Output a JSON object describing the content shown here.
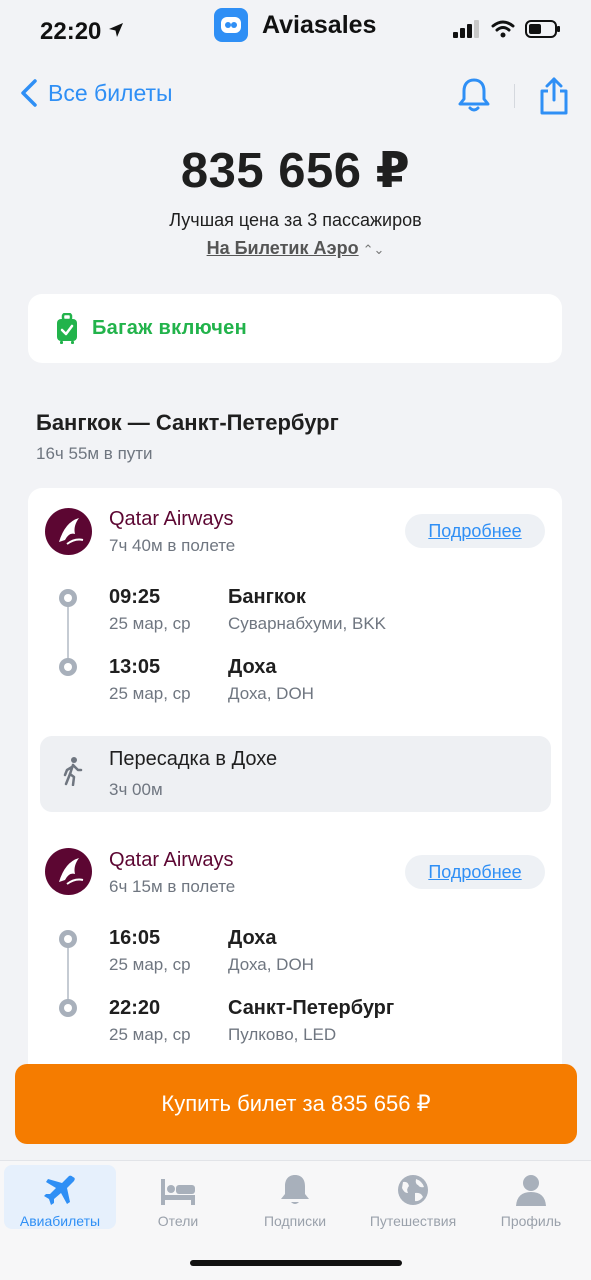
{
  "status_bar": {
    "time": "22:20",
    "app_name": "Aviasales"
  },
  "nav": {
    "back_label": "Все билеты",
    "bell_icon": "bell-icon",
    "share_icon": "share-icon"
  },
  "price": {
    "amount": "835 656 ₽",
    "subtitle": "Лучшая цена за 3 пассажиров",
    "agency": "На Билетик Аэро"
  },
  "baggage": {
    "label": "Багаж включен",
    "color": "#22B34B"
  },
  "route": {
    "title": "Бангкок — Санкт-Петербург",
    "duration": "16ч 55м в пути"
  },
  "legs": [
    {
      "airline": "Qatar Airways",
      "flight_time": "7ч 40м в полете",
      "details_label": "Подробнее",
      "departure": {
        "time": "09:25",
        "date": "25 мар, ср",
        "city": "Бангкок",
        "airport": "Суварнабхуми, BKK"
      },
      "arrival": {
        "time": "13:05",
        "date": "25 мар, ср",
        "city": "Доха",
        "airport": "Доха, DOH"
      }
    },
    {
      "airline": "Qatar Airways",
      "flight_time": "6ч 15м в полете",
      "details_label": "Подробнее",
      "departure": {
        "time": "16:05",
        "date": "25 мар, ср",
        "city": "Доха",
        "airport": "Доха, DOH"
      },
      "arrival": {
        "time": "22:20",
        "date": "25 мар, ср",
        "city": "Санкт-Петербург",
        "airport": "Пулково, LED"
      }
    }
  ],
  "layover": {
    "title": "Пересадка в Дохе",
    "duration": "3ч 00м"
  },
  "buy_button": {
    "label": "Купить билет за 835 656 ₽",
    "color": "#F57C00"
  },
  "tabbar": {
    "items": [
      {
        "label": "Авиабилеты",
        "icon": "plane-icon",
        "active": true
      },
      {
        "label": "Отели",
        "icon": "bed-icon",
        "active": false
      },
      {
        "label": "Подписки",
        "icon": "bell-icon",
        "active": false
      },
      {
        "label": "Путешествия",
        "icon": "globe-icon",
        "active": false
      },
      {
        "label": "Профиль",
        "icon": "profile-icon",
        "active": false
      }
    ]
  },
  "colors": {
    "accent": "#2F8FF5",
    "airline": "#5C0632",
    "background": "#F2F3F6"
  }
}
